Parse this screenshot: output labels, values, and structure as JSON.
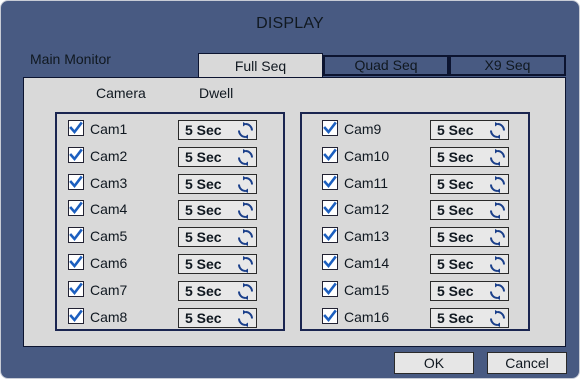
{
  "title": "DISPLAY",
  "main_monitor_label": "Main Monitor",
  "tabs": [
    {
      "label": "Full Seq",
      "active": true
    },
    {
      "label": "Quad Seq",
      "active": false
    },
    {
      "label": "X9 Seq",
      "active": false
    }
  ],
  "headers": {
    "camera": "Camera",
    "dwell": "Dwell"
  },
  "left_group": [
    {
      "name": "Cam1",
      "checked": true,
      "dwell": "5 Sec"
    },
    {
      "name": "Cam2",
      "checked": true,
      "dwell": "5 Sec"
    },
    {
      "name": "Cam3",
      "checked": true,
      "dwell": "5 Sec"
    },
    {
      "name": "Cam4",
      "checked": true,
      "dwell": "5 Sec"
    },
    {
      "name": "Cam5",
      "checked": true,
      "dwell": "5 Sec"
    },
    {
      "name": "Cam6",
      "checked": true,
      "dwell": "5 Sec"
    },
    {
      "name": "Cam7",
      "checked": true,
      "dwell": "5 Sec"
    },
    {
      "name": "Cam8",
      "checked": true,
      "dwell": "5 Sec"
    }
  ],
  "right_group": [
    {
      "name": "Cam9",
      "checked": true,
      "dwell": "5 Sec"
    },
    {
      "name": "Cam10",
      "checked": true,
      "dwell": "5 Sec"
    },
    {
      "name": "Cam11",
      "checked": true,
      "dwell": "5 Sec"
    },
    {
      "name": "Cam12",
      "checked": true,
      "dwell": "5 Sec"
    },
    {
      "name": "Cam13",
      "checked": true,
      "dwell": "5 Sec"
    },
    {
      "name": "Cam14",
      "checked": true,
      "dwell": "5 Sec"
    },
    {
      "name": "Cam15",
      "checked": true,
      "dwell": "5 Sec"
    },
    {
      "name": "Cam16",
      "checked": true,
      "dwell": "5 Sec"
    }
  ],
  "buttons": {
    "ok": "OK",
    "cancel": "Cancel"
  },
  "icons": {
    "checkbox": "checkmark-icon",
    "spinner": "cycle-arrows-icon"
  },
  "colors": {
    "background": "#485a82",
    "panel": "#d9d9d9",
    "check": "#1c5fbf",
    "spinner": "#1a3f8a"
  }
}
